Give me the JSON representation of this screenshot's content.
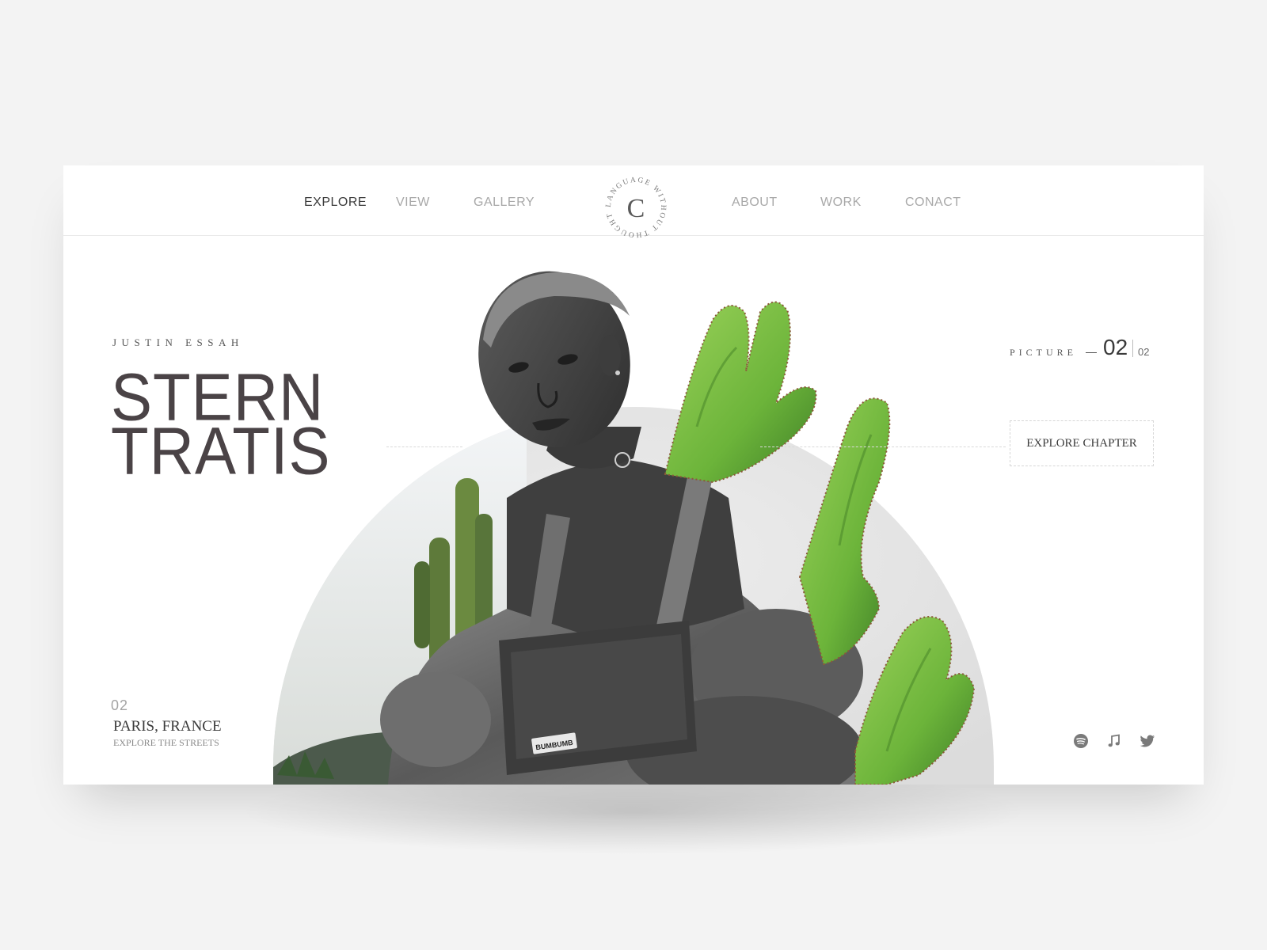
{
  "nav": {
    "left_items": [
      {
        "label": "EXPLORE",
        "active": true
      },
      {
        "label": "VIEW",
        "active": false
      },
      {
        "label": "GALLERY",
        "active": false
      }
    ],
    "right_items": [
      {
        "label": "ABOUT",
        "active": false
      },
      {
        "label": "WORK",
        "active": false
      },
      {
        "label": "CONACT",
        "active": false
      }
    ],
    "logo_letter": "C",
    "logo_ring_text": "LANGUAGE WITHOUT THOUGHT"
  },
  "hero": {
    "author": "JUSTIN ESSAH",
    "title_line1": "STERN",
    "title_line2": "TRATIS",
    "picture_label": "PICTURE",
    "picture_current": "02",
    "picture_total": "02",
    "explore_label": "EXPLORE CHAPTER",
    "badge_text": "BUMBUMB"
  },
  "location": {
    "number": "02",
    "city": "PARIS, FRANCE",
    "tagline": "EXPLORE THE STREETS"
  },
  "social": [
    {
      "icon": "spotify-icon"
    },
    {
      "icon": "music-note-icon"
    },
    {
      "icon": "twitter-icon"
    }
  ],
  "colors": {
    "accent_text": "#4a4346",
    "cactus_green": "#7cc243",
    "background": "#f3f3f3"
  }
}
